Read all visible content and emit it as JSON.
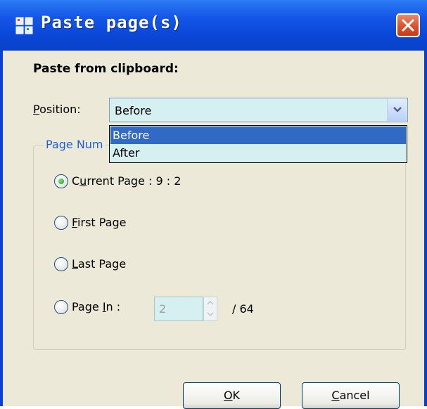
{
  "window": {
    "title": "Paste page(s)",
    "close_icon": "close-icon"
  },
  "dialog": {
    "heading": "Paste from clipboard:",
    "position_label": "Position:",
    "position_value": "Before",
    "position_options": [
      "Before",
      "After"
    ],
    "group_title": "Page Num",
    "radios": [
      {
        "label": "Current Page : 9 : 2",
        "checked": true
      },
      {
        "label": "First Page",
        "checked": false
      },
      {
        "label": "Last Page",
        "checked": false
      },
      {
        "label": "Page In :",
        "checked": false
      }
    ],
    "page_in_value": "2",
    "page_total": "/ 64",
    "ok_label": "OK",
    "cancel_label": "Cancel"
  },
  "colors": {
    "title_bar": "#0a47d7",
    "dialog_bg": "#ece9d8",
    "field_bg": "#d6f0f1",
    "selection": "#316ac5",
    "group_title": "#2060d8"
  }
}
